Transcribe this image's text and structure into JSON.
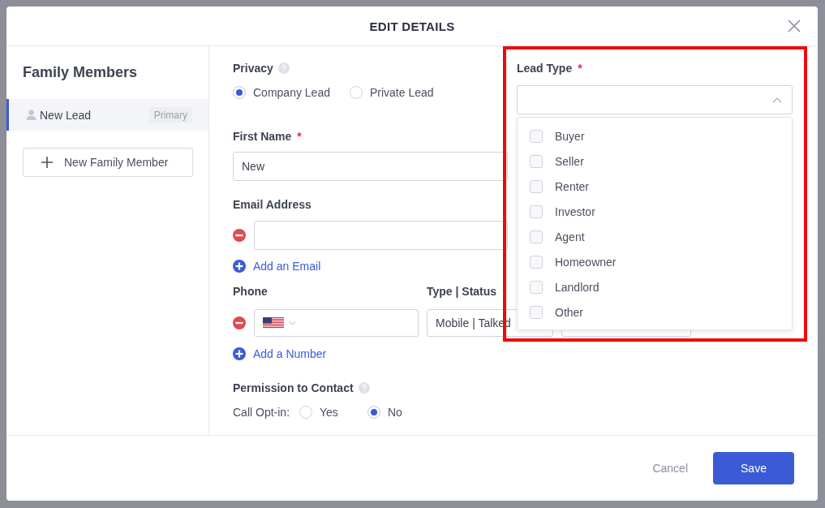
{
  "dialog": {
    "title": "EDIT DETAILS"
  },
  "sidebar": {
    "title": "Family Members",
    "members": [
      {
        "name": "New Lead",
        "badge": "Primary",
        "selected": true
      }
    ],
    "add_button": "New Family Member"
  },
  "privacy": {
    "label": "Privacy",
    "options": [
      {
        "label": "Company Lead",
        "selected": true
      },
      {
        "label": "Private Lead",
        "selected": false
      }
    ]
  },
  "first_name": {
    "label": "First Name",
    "required_mark": "*",
    "value": "New"
  },
  "email": {
    "label": "Email Address",
    "add_link": "Add an Email"
  },
  "phone": {
    "label": "Phone",
    "type_label": "Type | Status",
    "type_value": "Mobile | Talked",
    "add_link": "Add a Number"
  },
  "permission": {
    "label": "Permission to Contact",
    "call_opt_in": {
      "label": "Call Opt-in:",
      "options": [
        {
          "label": "Yes",
          "selected": false
        },
        {
          "label": "No",
          "selected": true
        }
      ]
    }
  },
  "lead_type": {
    "label": "Lead Type",
    "required_mark": "*",
    "expanded": true,
    "options": [
      {
        "label": "Buyer",
        "checked": false
      },
      {
        "label": "Seller",
        "checked": false
      },
      {
        "label": "Renter",
        "checked": false
      },
      {
        "label": "Investor",
        "checked": false
      },
      {
        "label": "Agent",
        "checked": false
      },
      {
        "label": "Homeowner",
        "checked": false
      },
      {
        "label": "Landlord",
        "checked": false
      },
      {
        "label": "Other",
        "checked": false
      }
    ]
  },
  "footer": {
    "cancel": "Cancel",
    "save": "Save"
  }
}
